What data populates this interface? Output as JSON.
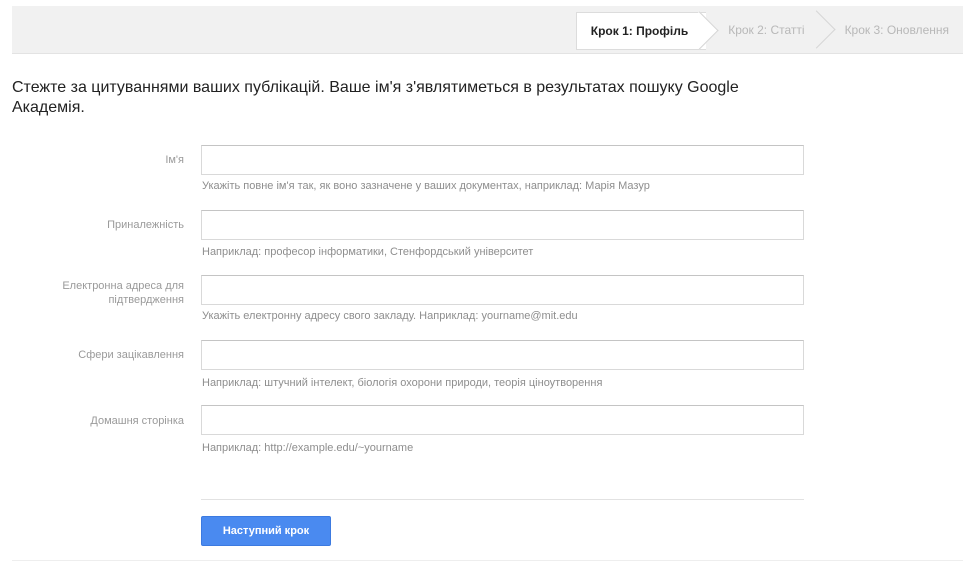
{
  "steps": {
    "step1": "Крок 1: Профіль",
    "step2": "Крок 2: Статті",
    "step3": "Крок 3: Оновлення"
  },
  "intro": "Стежте за цитуваннями ваших публікацій. Ваше ім'я з'являтиметься в результатах пошуку Google Академія.",
  "fields": {
    "name": {
      "label": "Ім'я",
      "value": "",
      "hint": "Укажіть повне ім'я так, як воно зазначене у ваших документах, наприклад: Марія Мазур"
    },
    "affiliation": {
      "label": "Приналежність",
      "value": "",
      "hint": "Наприклад: професор інформатики, Стенфордський університет"
    },
    "email": {
      "label": "Електронна адреса для підтвердження",
      "value": "",
      "hint": "Укажіть електронну адресу свого закладу. Наприклад: yourname@mit.edu"
    },
    "interests": {
      "label": "Сфери зацікавлення",
      "value": "",
      "hint": "Наприклад: штучний інтелект, біологія охорони природи, теорія ціноутворення"
    },
    "homepage": {
      "label": "Домашня сторінка",
      "value": "",
      "hint": "Наприклад: http://example.edu/~yourname"
    }
  },
  "buttons": {
    "next": "Наступний крок"
  },
  "colors": {
    "accent": "#4a8af0",
    "topbar": "#f1f1f1"
  }
}
